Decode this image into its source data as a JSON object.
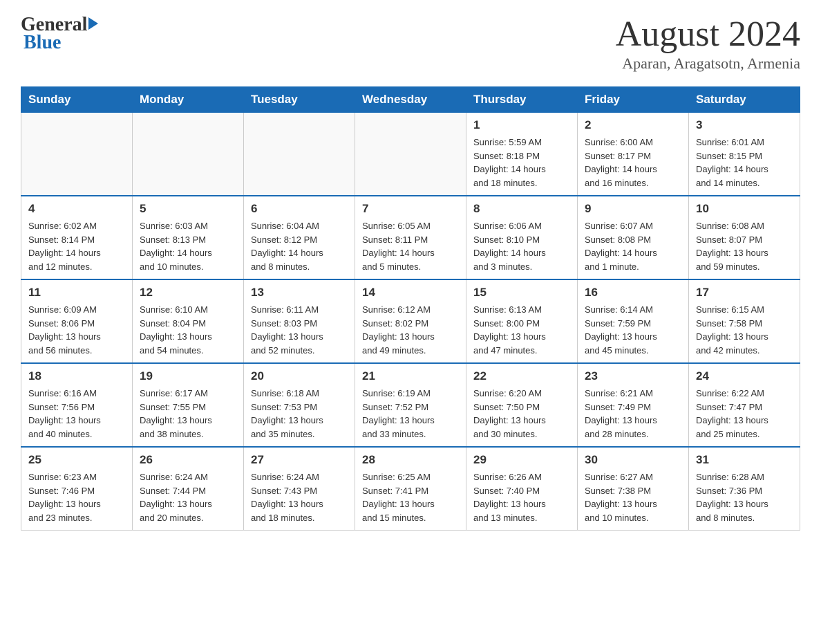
{
  "logo": {
    "general": "General",
    "blue": "Blue"
  },
  "title": "August 2024",
  "subtitle": "Aparan, Aragatsotn, Armenia",
  "days": [
    "Sunday",
    "Monday",
    "Tuesday",
    "Wednesday",
    "Thursday",
    "Friday",
    "Saturday"
  ],
  "weeks": [
    [
      {
        "num": "",
        "info": ""
      },
      {
        "num": "",
        "info": ""
      },
      {
        "num": "",
        "info": ""
      },
      {
        "num": "",
        "info": ""
      },
      {
        "num": "1",
        "info": "Sunrise: 5:59 AM\nSunset: 8:18 PM\nDaylight: 14 hours\nand 18 minutes."
      },
      {
        "num": "2",
        "info": "Sunrise: 6:00 AM\nSunset: 8:17 PM\nDaylight: 14 hours\nand 16 minutes."
      },
      {
        "num": "3",
        "info": "Sunrise: 6:01 AM\nSunset: 8:15 PM\nDaylight: 14 hours\nand 14 minutes."
      }
    ],
    [
      {
        "num": "4",
        "info": "Sunrise: 6:02 AM\nSunset: 8:14 PM\nDaylight: 14 hours\nand 12 minutes."
      },
      {
        "num": "5",
        "info": "Sunrise: 6:03 AM\nSunset: 8:13 PM\nDaylight: 14 hours\nand 10 minutes."
      },
      {
        "num": "6",
        "info": "Sunrise: 6:04 AM\nSunset: 8:12 PM\nDaylight: 14 hours\nand 8 minutes."
      },
      {
        "num": "7",
        "info": "Sunrise: 6:05 AM\nSunset: 8:11 PM\nDaylight: 14 hours\nand 5 minutes."
      },
      {
        "num": "8",
        "info": "Sunrise: 6:06 AM\nSunset: 8:10 PM\nDaylight: 14 hours\nand 3 minutes."
      },
      {
        "num": "9",
        "info": "Sunrise: 6:07 AM\nSunset: 8:08 PM\nDaylight: 14 hours\nand 1 minute."
      },
      {
        "num": "10",
        "info": "Sunrise: 6:08 AM\nSunset: 8:07 PM\nDaylight: 13 hours\nand 59 minutes."
      }
    ],
    [
      {
        "num": "11",
        "info": "Sunrise: 6:09 AM\nSunset: 8:06 PM\nDaylight: 13 hours\nand 56 minutes."
      },
      {
        "num": "12",
        "info": "Sunrise: 6:10 AM\nSunset: 8:04 PM\nDaylight: 13 hours\nand 54 minutes."
      },
      {
        "num": "13",
        "info": "Sunrise: 6:11 AM\nSunset: 8:03 PM\nDaylight: 13 hours\nand 52 minutes."
      },
      {
        "num": "14",
        "info": "Sunrise: 6:12 AM\nSunset: 8:02 PM\nDaylight: 13 hours\nand 49 minutes."
      },
      {
        "num": "15",
        "info": "Sunrise: 6:13 AM\nSunset: 8:00 PM\nDaylight: 13 hours\nand 47 minutes."
      },
      {
        "num": "16",
        "info": "Sunrise: 6:14 AM\nSunset: 7:59 PM\nDaylight: 13 hours\nand 45 minutes."
      },
      {
        "num": "17",
        "info": "Sunrise: 6:15 AM\nSunset: 7:58 PM\nDaylight: 13 hours\nand 42 minutes."
      }
    ],
    [
      {
        "num": "18",
        "info": "Sunrise: 6:16 AM\nSunset: 7:56 PM\nDaylight: 13 hours\nand 40 minutes."
      },
      {
        "num": "19",
        "info": "Sunrise: 6:17 AM\nSunset: 7:55 PM\nDaylight: 13 hours\nand 38 minutes."
      },
      {
        "num": "20",
        "info": "Sunrise: 6:18 AM\nSunset: 7:53 PM\nDaylight: 13 hours\nand 35 minutes."
      },
      {
        "num": "21",
        "info": "Sunrise: 6:19 AM\nSunset: 7:52 PM\nDaylight: 13 hours\nand 33 minutes."
      },
      {
        "num": "22",
        "info": "Sunrise: 6:20 AM\nSunset: 7:50 PM\nDaylight: 13 hours\nand 30 minutes."
      },
      {
        "num": "23",
        "info": "Sunrise: 6:21 AM\nSunset: 7:49 PM\nDaylight: 13 hours\nand 28 minutes."
      },
      {
        "num": "24",
        "info": "Sunrise: 6:22 AM\nSunset: 7:47 PM\nDaylight: 13 hours\nand 25 minutes."
      }
    ],
    [
      {
        "num": "25",
        "info": "Sunrise: 6:23 AM\nSunset: 7:46 PM\nDaylight: 13 hours\nand 23 minutes."
      },
      {
        "num": "26",
        "info": "Sunrise: 6:24 AM\nSunset: 7:44 PM\nDaylight: 13 hours\nand 20 minutes."
      },
      {
        "num": "27",
        "info": "Sunrise: 6:24 AM\nSunset: 7:43 PM\nDaylight: 13 hours\nand 18 minutes."
      },
      {
        "num": "28",
        "info": "Sunrise: 6:25 AM\nSunset: 7:41 PM\nDaylight: 13 hours\nand 15 minutes."
      },
      {
        "num": "29",
        "info": "Sunrise: 6:26 AM\nSunset: 7:40 PM\nDaylight: 13 hours\nand 13 minutes."
      },
      {
        "num": "30",
        "info": "Sunrise: 6:27 AM\nSunset: 7:38 PM\nDaylight: 13 hours\nand 10 minutes."
      },
      {
        "num": "31",
        "info": "Sunrise: 6:28 AM\nSunset: 7:36 PM\nDaylight: 13 hours\nand 8 minutes."
      }
    ]
  ]
}
